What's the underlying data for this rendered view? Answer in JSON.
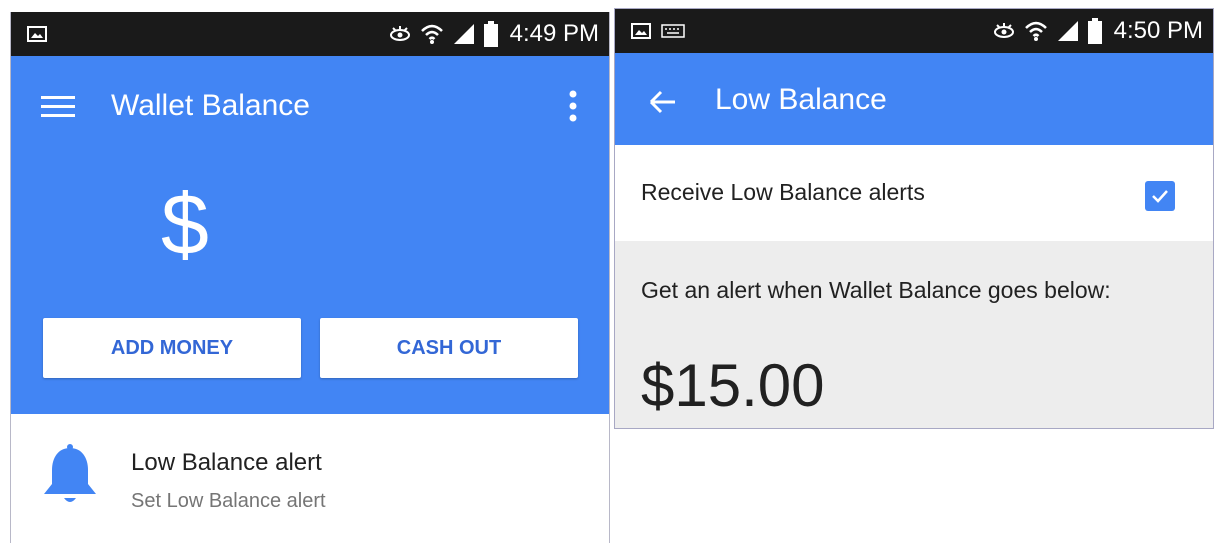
{
  "screens": [
    {
      "status_time": "4:49 PM",
      "title": "Wallet Balance",
      "balance_symbol": "$",
      "buttons": {
        "add_money": "ADD MONEY",
        "cash_out": "CASH OUT"
      },
      "list_item": {
        "primary": "Low Balance alert",
        "secondary": "Set Low Balance alert"
      }
    },
    {
      "status_time": "4:50 PM",
      "title": "Low Balance",
      "setting_label": "Receive Low Balance alerts",
      "setting_checked": true,
      "description": "Get an alert when Wallet Balance goes below:",
      "threshold_amount": "$15.00"
    }
  ],
  "colors": {
    "primary": "#4285f4",
    "button_text": "#3367d6",
    "status_bar": "#1a1a1a",
    "secondary_bg": "#ededed"
  },
  "icons": {
    "status_left_screen1": [
      "image-icon"
    ],
    "status_left_screen2": [
      "image-icon",
      "keyboard-icon"
    ],
    "status_right": [
      "eye-icon",
      "wifi-icon",
      "signal-icon",
      "battery-icon"
    ],
    "appbar_screen1": [
      "menu-icon",
      "more-vert-icon"
    ],
    "appbar_screen2": [
      "arrow-back-icon"
    ],
    "list_item": "bell-icon",
    "setting": "checkbox-checked-icon"
  }
}
